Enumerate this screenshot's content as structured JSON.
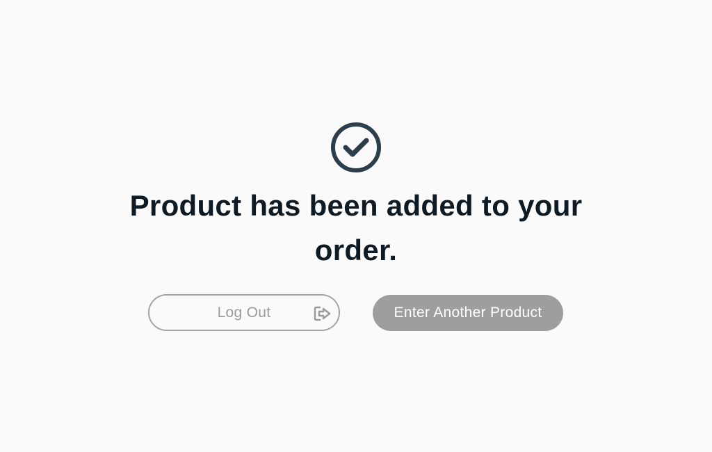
{
  "confirmation": {
    "icon": "check-circle-icon",
    "message": "Product has been added to your order."
  },
  "actions": {
    "logout_label": "Log Out",
    "logout_icon": "logout-icon",
    "enter_another_label": "Enter Another Product"
  },
  "colors": {
    "background": "#fafafa",
    "heading": "#0f1b24",
    "icon": "#2c3e4a",
    "secondary_button_border": "#a3a3a3",
    "secondary_button_text": "#9a9a9a",
    "primary_button_bg": "#9e9e9e",
    "primary_button_text": "#ffffff"
  }
}
